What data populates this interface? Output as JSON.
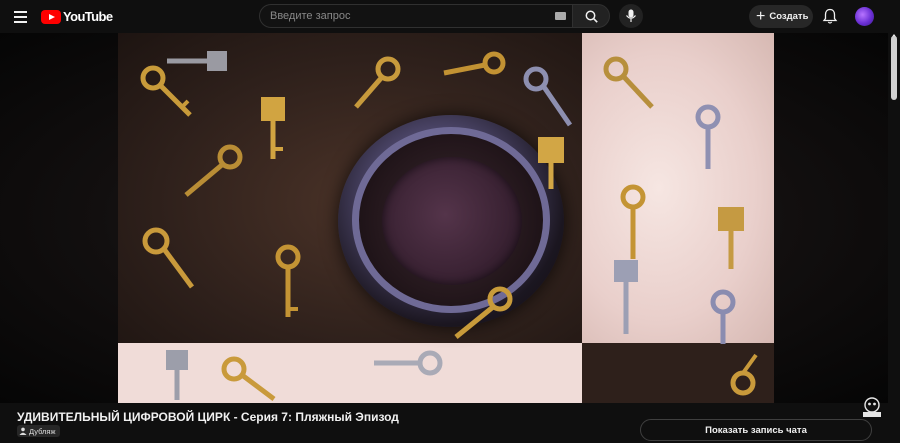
{
  "header": {
    "logo_text": "YouTube",
    "search_placeholder": "Введите запрос",
    "create_label": "Создать"
  },
  "video": {
    "title": "УДИВИТЕЛЬНЫЙ ЦИФРОВОЙ ЦИРК - Серия 7: Пляжный Эпизод",
    "audio_badge": "Дубляж",
    "chat_button": "Показать запись чата"
  },
  "icons": {
    "menu": "menu-icon",
    "logo": "youtube-logo-icon",
    "keyboard": "keyboard-icon",
    "search": "search-icon",
    "mic": "microphone-icon",
    "create": "plus-icon",
    "notifications": "bell-icon",
    "avatar": "avatar",
    "dub": "person-icon",
    "watermark": "channel-watermark-icon"
  },
  "colors": {
    "background": "#0f0f0f",
    "brand_red": "#ff0000",
    "button_bg": "#272727",
    "text": "#f1f1f1"
  }
}
